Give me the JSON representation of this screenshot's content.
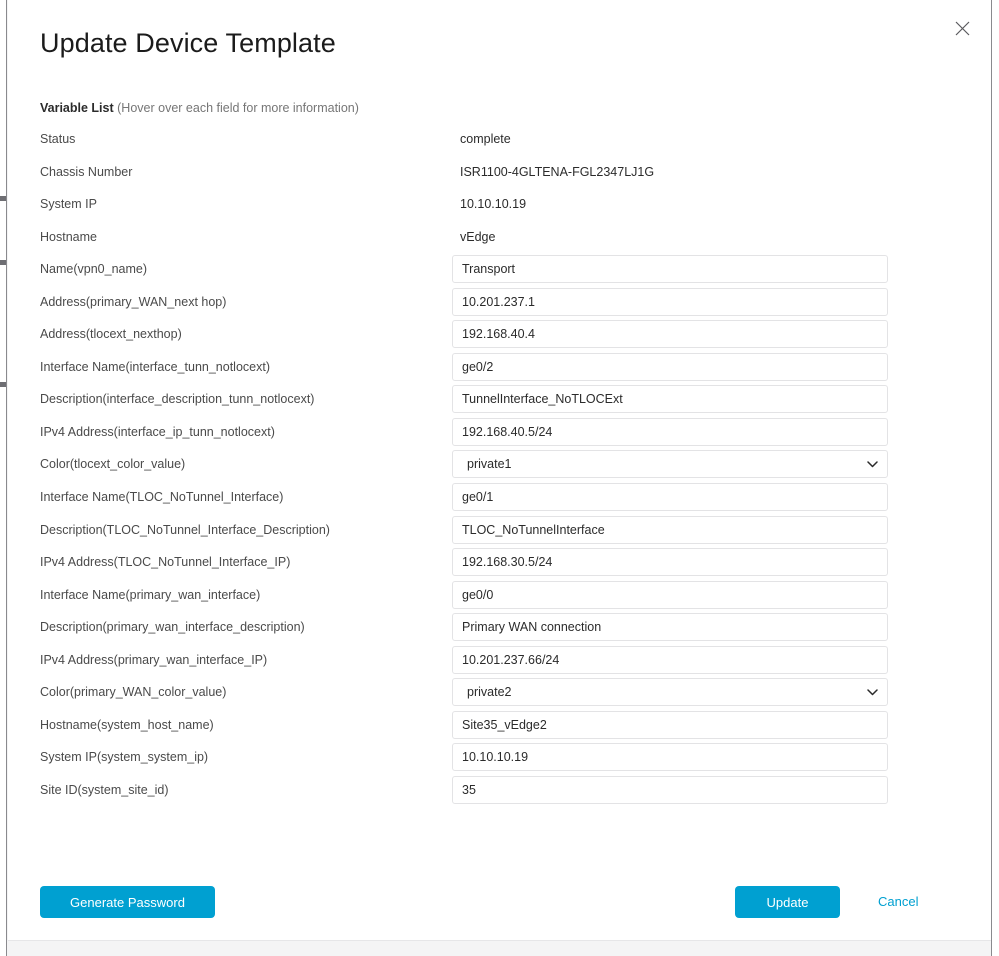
{
  "window": {
    "title": "Update Device Template",
    "close_icon": "close-icon"
  },
  "variable_list": {
    "heading": "Variable List",
    "hint": "(Hover over each field for more information)"
  },
  "static_rows": [
    {
      "label": "Status",
      "value": "complete"
    },
    {
      "label": "Chassis Number",
      "value": "ISR1100-4GLTENA-FGL2347LJ1G"
    },
    {
      "label": "System IP",
      "value": "10.10.10.19"
    },
    {
      "label": "Hostname",
      "value": "vEdge"
    }
  ],
  "field_rows": [
    {
      "label": "Name(vpn0_name)",
      "type": "text",
      "value": "Transport"
    },
    {
      "label": "Address(primary_WAN_next hop)",
      "type": "text",
      "value": "10.201.237.1"
    },
    {
      "label": "Address(tlocext_nexthop)",
      "type": "text",
      "value": "192.168.40.4"
    },
    {
      "label": "Interface Name(interface_tunn_notlocext)",
      "type": "text",
      "value": "ge0/2"
    },
    {
      "label": "Description(interface_description_tunn_notlocext)",
      "type": "text",
      "value": "TunnelInterface_NoTLOCExt"
    },
    {
      "label": "IPv4 Address(interface_ip_tunn_notlocext)",
      "type": "text",
      "value": "192.168.40.5/24"
    },
    {
      "label": "Color(tlocext_color_value)",
      "type": "select",
      "value": "private1"
    },
    {
      "label": "Interface Name(TLOC_NoTunnel_Interface)",
      "type": "text",
      "value": "ge0/1"
    },
    {
      "label": "Description(TLOC_NoTunnel_Interface_Description)",
      "type": "text",
      "value": "TLOC_NoTunnelInterface"
    },
    {
      "label": "IPv4 Address(TLOC_NoTunnel_Interface_IP)",
      "type": "text",
      "value": "192.168.30.5/24"
    },
    {
      "label": "Interface Name(primary_wan_interface)",
      "type": "text",
      "value": "ge0/0"
    },
    {
      "label": "Description(primary_wan_interface_description)",
      "type": "text",
      "value": "Primary WAN connection"
    },
    {
      "label": "IPv4 Address(primary_wan_interface_IP)",
      "type": "text",
      "value": "10.201.237.66/24"
    },
    {
      "label": "Color(primary_WAN_color_value)",
      "type": "select",
      "value": "private2"
    },
    {
      "label": "Hostname(system_host_name)",
      "type": "text",
      "value": "Site35_vEdge2"
    },
    {
      "label": "System IP(system_system_ip)",
      "type": "text",
      "value": "10.10.10.19"
    },
    {
      "label": "Site ID(system_site_id)",
      "type": "text",
      "value": "35"
    }
  ],
  "footer": {
    "generate_password_label": "Generate Password",
    "update_label": "Update",
    "cancel_label": "Cancel"
  },
  "colors": {
    "accent": "#00a0d1",
    "field_border": "#e3e3e5",
    "label_text": "#4a4a4a"
  }
}
